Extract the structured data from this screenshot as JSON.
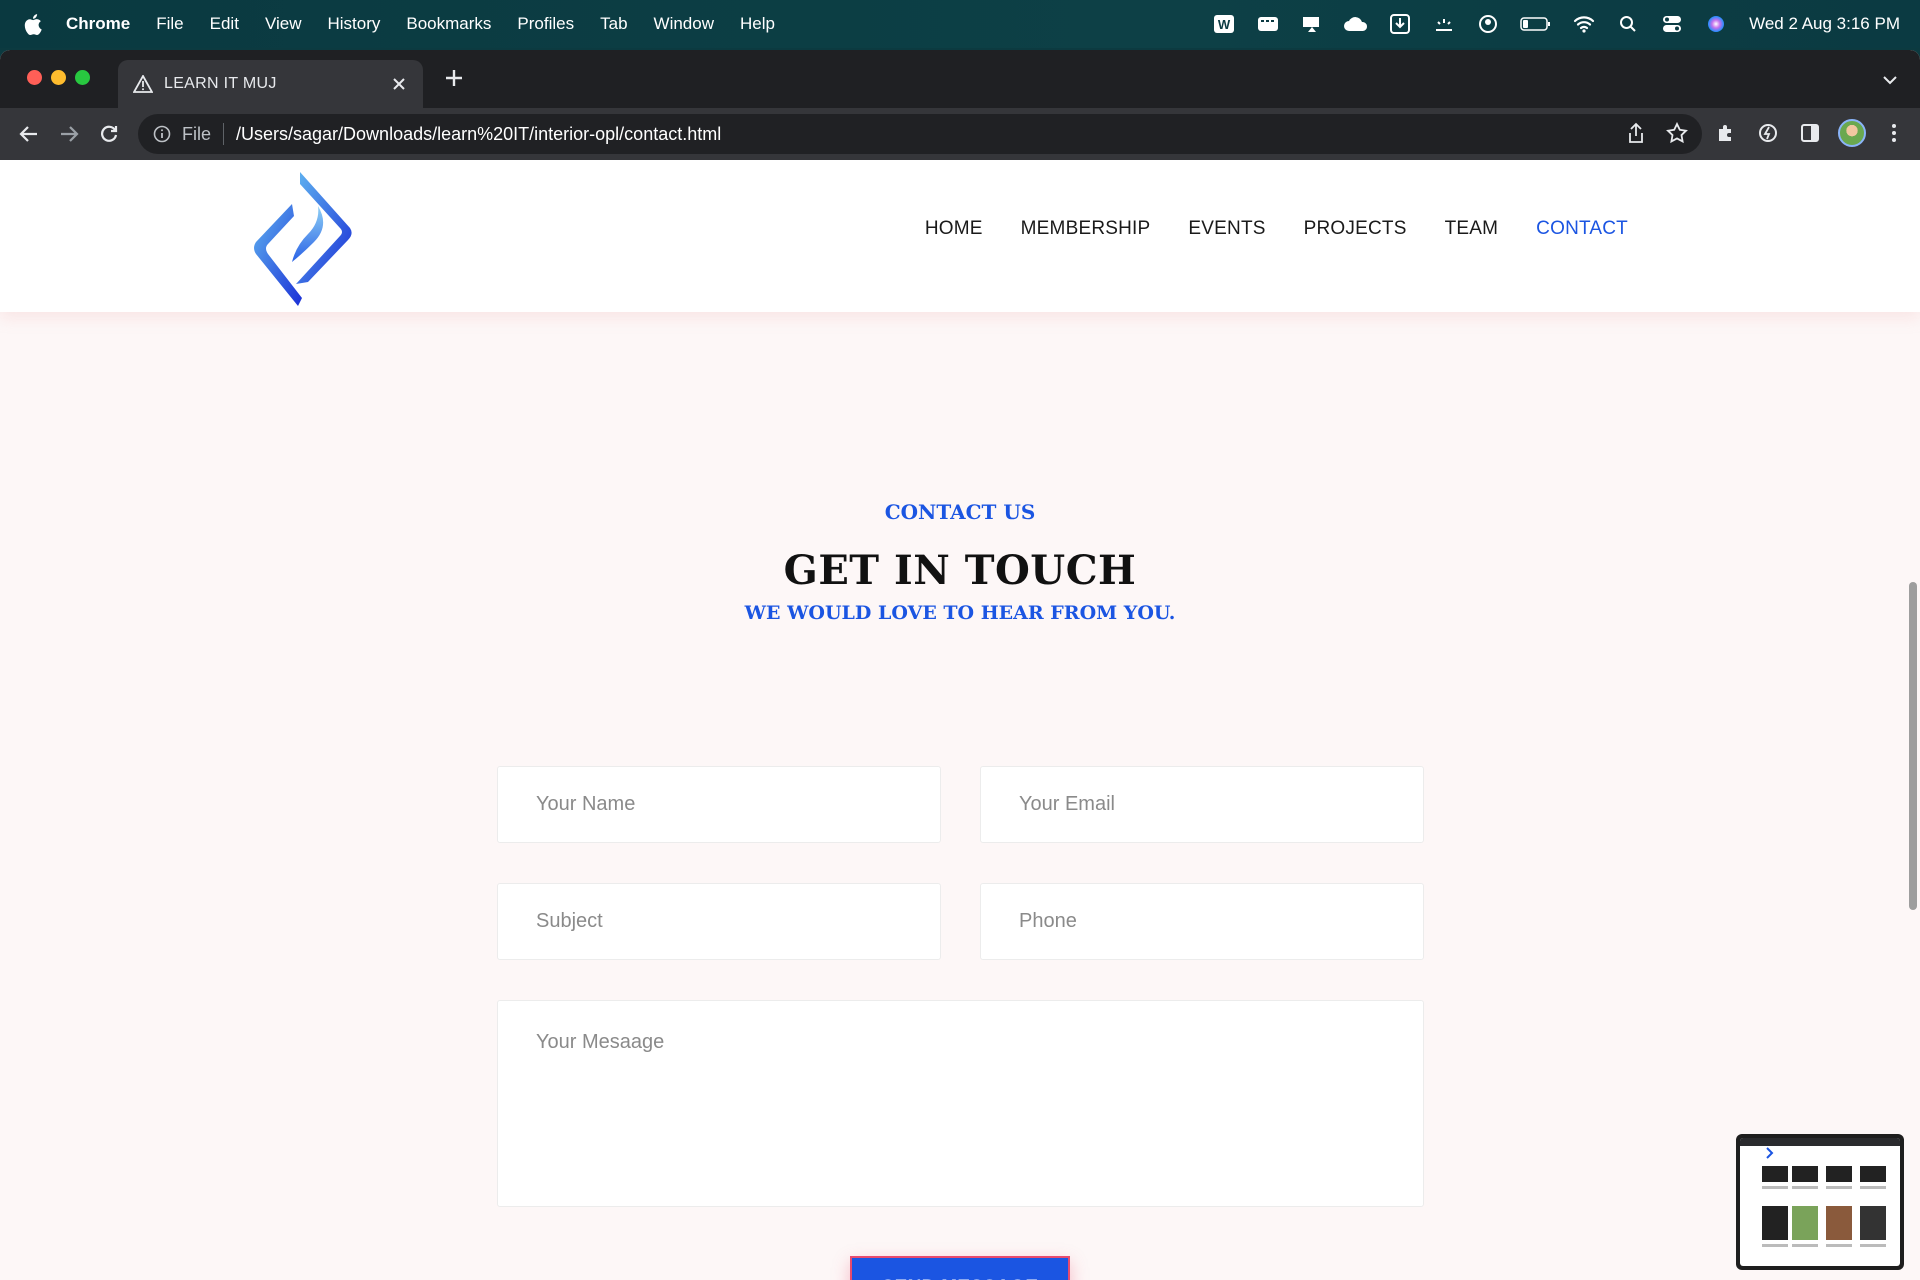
{
  "menubar": {
    "app": "Chrome",
    "items": [
      "File",
      "Edit",
      "View",
      "History",
      "Bookmarks",
      "Profiles",
      "Tab",
      "Window",
      "Help"
    ],
    "clock": "Wed 2 Aug  3:16 PM"
  },
  "browser": {
    "tab_title": "LEARN IT MUJ",
    "scheme_label": "File",
    "url": "/Users/sagar/Downloads/learn%20IT/interior-opl/contact.html"
  },
  "site": {
    "nav": [
      "HOME",
      "MEMBERSHIP",
      "EVENTS",
      "PROJECTS",
      "TEAM",
      "CONTACT"
    ],
    "active_nav": "CONTACT",
    "accent_color": "#1b55e2"
  },
  "contact": {
    "eyebrow": "CONTACT US",
    "headline": "GET IN TOUCH",
    "subhead": "WE WOULD LOVE TO HEAR FROM YOU.",
    "fields": {
      "name_placeholder": "Your Name",
      "email_placeholder": "Your Email",
      "subject_placeholder": "Subject",
      "phone_placeholder": "Phone",
      "message_placeholder": "Your Mesaage"
    },
    "send_label": "SEND MESSAGE"
  }
}
